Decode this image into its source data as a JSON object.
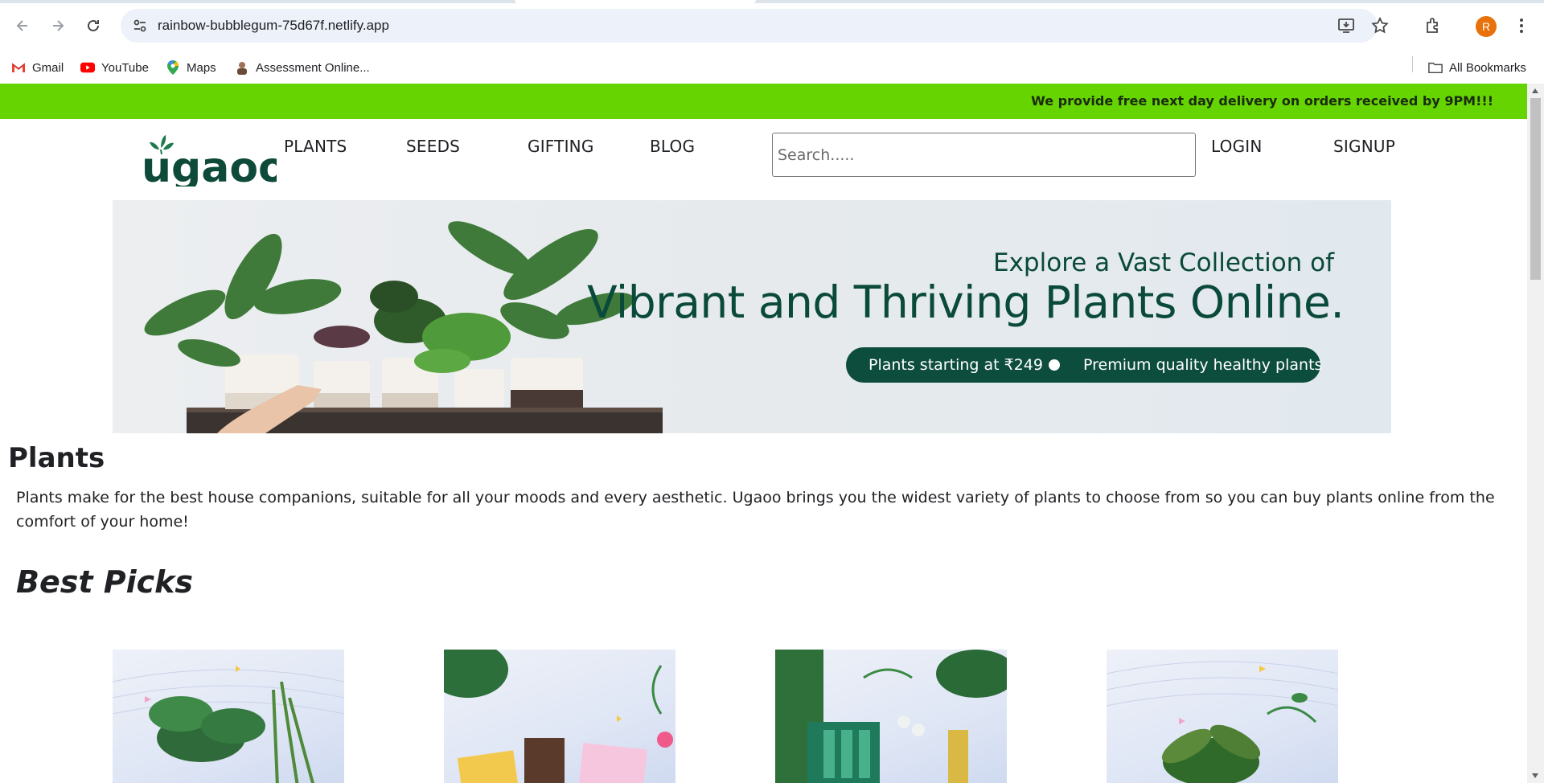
{
  "browser": {
    "url": "rainbow-bubblegum-75d67f.netlify.app",
    "avatar_initial": "R",
    "bookmarks": [
      {
        "label": "Gmail",
        "icon": "gmail-icon"
      },
      {
        "label": "YouTube",
        "icon": "youtube-icon"
      },
      {
        "label": "Maps",
        "icon": "maps-icon"
      },
      {
        "label": "Assessment Online...",
        "icon": "assessment-favicon"
      }
    ],
    "all_bookmarks_label": "All Bookmarks"
  },
  "promo": {
    "text": "We provide free next day delivery on orders received by 9PM!!!",
    "color": "#66d400"
  },
  "header": {
    "logo_text": "ugaoo",
    "nav": [
      "PLANTS",
      "SEEDS",
      "GIFTING",
      "BLOG"
    ],
    "search_placeholder": "Search.....",
    "login": "LOGIN",
    "signup": "SIGNUP"
  },
  "banner": {
    "line1": "Explore a Vast Collection of",
    "line2": "Vibrant and Thriving Plants Online.",
    "pill_left": "Plants starting at ₹249",
    "pill_right": "Premium quality healthy plants"
  },
  "plants_section": {
    "title": "Plants",
    "description": "Plants make for the best house companions, suitable for all your moods and every aesthetic. Ugaoo brings you the widest variety of plants to choose from so you can buy plants online from the comfort of your home!"
  },
  "best_picks": {
    "title": "Best Picks"
  },
  "colors": {
    "brand_green": "#0d4d3e",
    "logo_green": "#1f7a4d"
  }
}
